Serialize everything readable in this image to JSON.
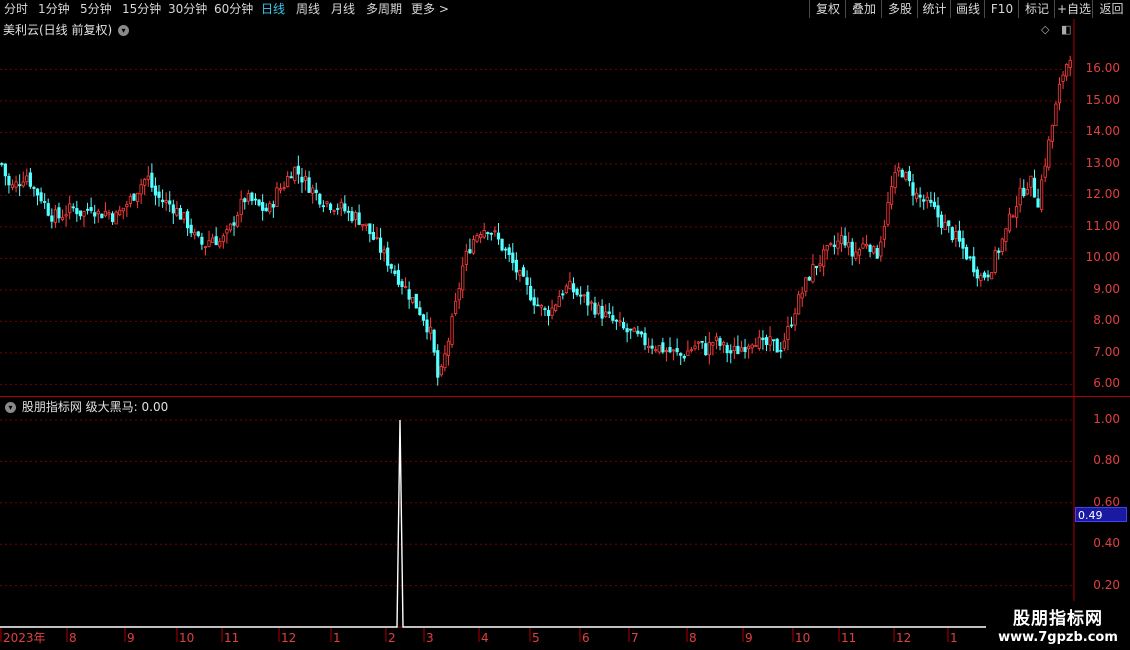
{
  "toolbar": {
    "periods": [
      "分时",
      "1分钟",
      "5分钟",
      "15分钟",
      "30分钟",
      "60分钟",
      "日线",
      "周线",
      "月线",
      "多周期",
      "更多 >"
    ],
    "active_period": "日线",
    "tools": [
      "复权",
      "叠加",
      "多股",
      "统计",
      "画线",
      "F10",
      "标记",
      "+自选",
      "返回"
    ]
  },
  "main_chart": {
    "title": "美利云(日线 前复权)",
    "price_labels": [
      "16.00",
      "15.00",
      "14.00",
      "13.00",
      "12.00",
      "11.00",
      "10.00",
      "9.00",
      "8.00",
      "7.00",
      "6.00"
    ]
  },
  "indicator_chart": {
    "title": "股朋指标网  级大黑马: 0.00",
    "labels": [
      "1.00",
      "0.80",
      "0.60",
      "0.40",
      "0.20"
    ],
    "current_value": "0.49"
  },
  "time_axis": {
    "labels": [
      "2023年",
      "8",
      "9",
      "10",
      "11",
      "12",
      "1",
      "2",
      "3",
      "4",
      "5",
      "6",
      "7",
      "8",
      "9",
      "10",
      "11",
      "12",
      "1"
    ]
  },
  "watermark": {
    "line1": "股朋指标网",
    "line2": "www.7gpzb.com"
  },
  "colors": {
    "up": "#ff3c3c",
    "down": "#54ffff",
    "grid": "#7a0000",
    "axis": "#b00000",
    "active_tab": "#36c8f0"
  },
  "chart_data": {
    "type": "candlestick",
    "ylim": [
      5.6,
      17.6
    ],
    "close_path": [
      13.0,
      12.2,
      12.4,
      12.7,
      12.2,
      11.9,
      11.4,
      11.3,
      11.5,
      11.6,
      11.4,
      11.7,
      11.4,
      11.5,
      11.3,
      11.6,
      11.9,
      12.3,
      12.6,
      12.0,
      11.8,
      11.7,
      11.4,
      11.1,
      10.6,
      10.4,
      10.7,
      10.5,
      10.8,
      11.4,
      11.9,
      11.8,
      11.6,
      11.5,
      12.1,
      12.4,
      12.9,
      12.6,
      12.3,
      12.0,
      11.8,
      11.7,
      11.6,
      11.4,
      11.3,
      11.0,
      10.6,
      10.2,
      9.8,
      9.4,
      9.0,
      8.6,
      8.2,
      7.6,
      6.0,
      7.2,
      8.4,
      9.8,
      10.5,
      10.9,
      11.0,
      10.7,
      10.3,
      9.9,
      9.4,
      9.0,
      8.6,
      8.3,
      8.4,
      8.9,
      9.1,
      8.9,
      8.7,
      8.5,
      8.3,
      8.1,
      7.9,
      7.7,
      7.6,
      7.4,
      7.3,
      7.2,
      7.1,
      7.0,
      6.9,
      7.1,
      7.3,
      7.1,
      7.4,
      7.2,
      7.0,
      7.1,
      7.3,
      7.5,
      7.2,
      7.3,
      7.1,
      7.6,
      8.4,
      9.0,
      9.6,
      9.9,
      10.2,
      10.4,
      10.7,
      10.1,
      10.3,
      10.6,
      10.0,
      11.1,
      12.3,
      12.9,
      12.4,
      12.0,
      11.8,
      11.6,
      11.2,
      10.9,
      10.6,
      10.2,
      9.8,
      9.4,
      9.6,
      10.2,
      10.8,
      11.6,
      12.1,
      12.5,
      11.8,
      13.2,
      14.5,
      15.8,
      16.5
    ]
  }
}
